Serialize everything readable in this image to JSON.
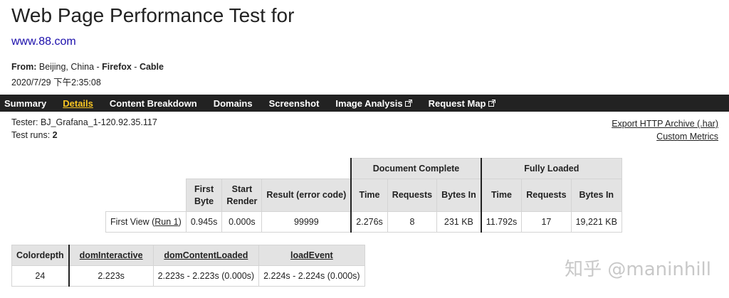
{
  "page": {
    "title": "Web Page Performance Test for",
    "url": "www.88.com",
    "from_label": "From:",
    "from_location": " Beijing, China - ",
    "browser": "Firefox",
    "sep": " - ",
    "connection": "Cable",
    "datetime": "2020/7/29 下午2:35:08"
  },
  "nav": {
    "items": [
      {
        "label": "Summary",
        "active": false,
        "external": false
      },
      {
        "label": "Details",
        "active": true,
        "external": false
      },
      {
        "label": "Content Breakdown",
        "active": false,
        "external": false
      },
      {
        "label": "Domains",
        "active": false,
        "external": false
      },
      {
        "label": "Screenshot",
        "active": false,
        "external": false
      },
      {
        "label": "Image Analysis",
        "active": false,
        "external": true
      },
      {
        "label": "Request Map",
        "active": false,
        "external": true
      }
    ]
  },
  "info": {
    "tester": "Tester: BJ_Grafana_1-120.92.35.117",
    "runs_label": "Test runs: ",
    "runs_value": "2",
    "export_link": "Export HTTP Archive (.har)",
    "custom_metrics_link": "Custom Metrics"
  },
  "perf_table": {
    "group_document_complete": "Document Complete",
    "group_fully_loaded": "Fully Loaded",
    "col_first_byte_1": "First",
    "col_first_byte_2": "Byte",
    "col_start_render_1": "Start",
    "col_start_render_2": "Render",
    "col_result": "Result (error code)",
    "col_dc_time": "Time",
    "col_dc_requests": "Requests",
    "col_dc_bytes": "Bytes In",
    "col_fl_time": "Time",
    "col_fl_requests": "Requests",
    "col_fl_bytes": "Bytes In",
    "row_label_pre": "First View (",
    "row_label_link": "Run 1",
    "row_label_post": ")",
    "first_byte": "0.945s",
    "start_render": "0.000s",
    "result": "99999",
    "dc_time": "2.276s",
    "dc_requests": "8",
    "dc_bytes": "231 KB",
    "fl_time": "11.792s",
    "fl_requests": "17",
    "fl_bytes": "19,221 KB"
  },
  "timings_table": {
    "headers": [
      "Colordepth",
      "domInteractive",
      "domContentLoaded",
      "loadEvent"
    ],
    "values": [
      "24",
      "2.223s",
      "2.223s - 2.223s (0.000s)",
      "2.224s - 2.224s (0.000s)"
    ]
  },
  "watermark": "知乎 @maninhill",
  "colors": {
    "nav_bg": "#222222",
    "nav_active": "#f9c623",
    "header_bg": "#e3e3e3",
    "link": "#1a0dab"
  }
}
